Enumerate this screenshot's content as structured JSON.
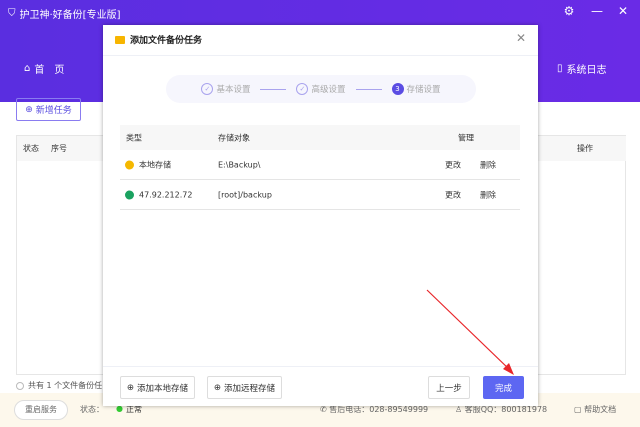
{
  "app": {
    "title": "护卫神·好备份[专业版]",
    "nav_home": "首　页",
    "nav_log": "系统日志"
  },
  "main": {
    "new_task": "新增任务",
    "columns": [
      "状态",
      "序号",
      "操作"
    ],
    "count_text": "共有 1 个文件备份任"
  },
  "footer": {
    "restart": "重启服务",
    "status_label": "状态：",
    "status_value": "正常",
    "phone": "售后电话：028-89549999",
    "qq": "客服QQ：800181978",
    "help": "帮助文档"
  },
  "dialog": {
    "title": "添加文件备份任务",
    "steps": [
      {
        "num": "✓",
        "label": "基本设置"
      },
      {
        "num": "✓",
        "label": "高级设置"
      },
      {
        "num": "3",
        "label": "存储设置"
      }
    ],
    "columns": {
      "type": "类型",
      "target": "存储对象",
      "manage": "管理"
    },
    "rows": [
      {
        "type": "本地存储",
        "target": "E:\\Backup\\",
        "edit": "更改",
        "delete": "删除",
        "color": "#f5b800"
      },
      {
        "type": "47.92.212.72",
        "target": "[root]/backup",
        "edit": "更改",
        "delete": "删除",
        "color": "#1aa260"
      }
    ],
    "add_local": "添加本地存储",
    "add_remote": "添加远程存储",
    "prev": "上一步",
    "done": "完成"
  },
  "colors": {
    "accent": "#5b2be0",
    "primary_button": "#5d67f2"
  }
}
